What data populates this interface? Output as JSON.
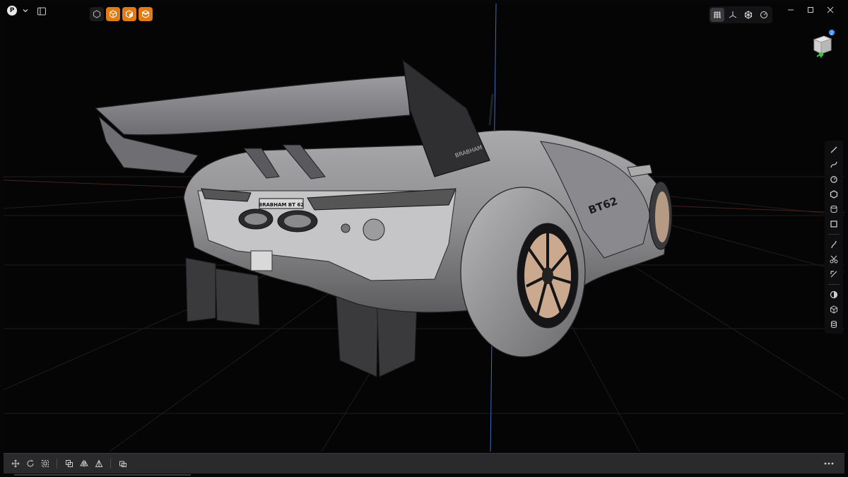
{
  "app": {
    "avatar_letter": "P"
  },
  "car": {
    "plate_text": "BRABHAM BT 62",
    "wing_text": "BRABHAM",
    "side_text": "BT62"
  },
  "view_cube": {
    "badge_count": "2"
  },
  "colors": {
    "accent": "#e07b16",
    "badge": "#3b8ef0",
    "axis_green": "#3fbf3f",
    "axis_blue": "#3d6cc9",
    "axis_red": "#c23a3a"
  },
  "selection_modes": [
    "select-object-icon",
    "select-body-icon",
    "select-face-icon",
    "select-edge-icon"
  ],
  "view_tools": [
    "grid-icon",
    "axis-icon",
    "render-mode-icon",
    "material-icon"
  ],
  "right_toolbar": [
    "line-icon",
    "curve-icon",
    "circle-icon",
    "polygon-icon",
    "cylinder-icon",
    "plane-icon",
    "spline-icon",
    "cut-icon",
    "measure-icon",
    "sphere-icon",
    "box-icon",
    "database-icon"
  ],
  "bottom_toolbar": [
    "move-icon",
    "rotate-icon",
    "scale-icon",
    "duplicate-icon",
    "mirror-icon",
    "align-icon",
    "group-icon"
  ]
}
